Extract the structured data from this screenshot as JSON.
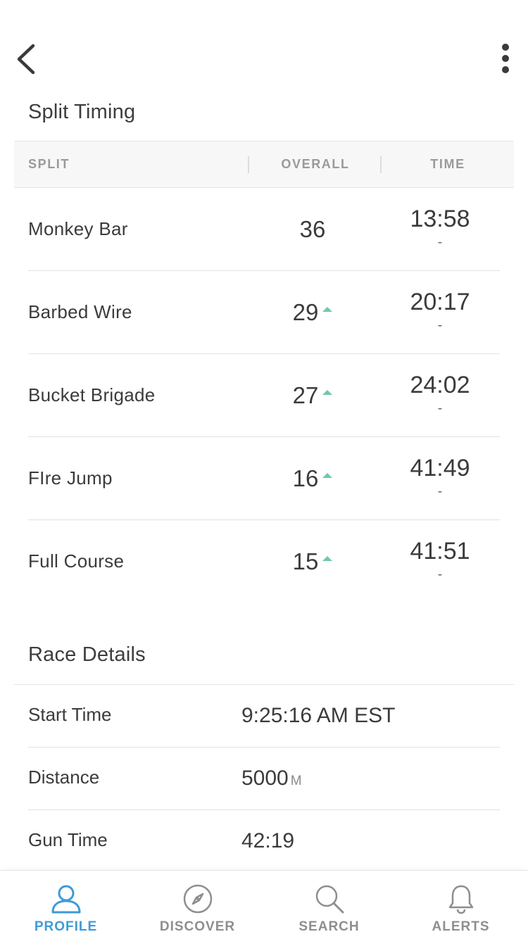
{
  "header": {
    "back_icon": "chevron-left-icon",
    "more_icon": "more-vertical-icon"
  },
  "split_timing": {
    "title": "Split Timing",
    "columns": {
      "split": "SPLIT",
      "overall": "OVERALL",
      "time": "TIME"
    },
    "rows": [
      {
        "name": "Monkey Bar",
        "overall": "36",
        "improved": false,
        "time": "13:58",
        "sub": "-"
      },
      {
        "name": "Barbed Wire",
        "overall": "29",
        "improved": true,
        "time": "20:17",
        "sub": "-"
      },
      {
        "name": "Bucket Brigade",
        "overall": "27",
        "improved": true,
        "time": "24:02",
        "sub": "-"
      },
      {
        "name": "FIre Jump",
        "overall": "16",
        "improved": true,
        "time": "41:49",
        "sub": "-"
      },
      {
        "name": "Full Course",
        "overall": "15",
        "improved": true,
        "time": "41:51",
        "sub": "-"
      }
    ],
    "improve_color": "#6fc9a4"
  },
  "race_details": {
    "title": "Race Details",
    "rows": [
      {
        "label": "Start Time",
        "value": "9:25:16 AM EST",
        "unit": ""
      },
      {
        "label": "Distance",
        "value": "5000",
        "unit": "M"
      },
      {
        "label": "Gun Time",
        "value": "42:19",
        "unit": ""
      }
    ]
  },
  "tabbar": {
    "tabs": [
      {
        "label": "PROFILE",
        "icon": "user-icon",
        "active": true
      },
      {
        "label": "DISCOVER",
        "icon": "compass-icon",
        "active": false
      },
      {
        "label": "SEARCH",
        "icon": "search-icon",
        "active": false
      },
      {
        "label": "ALERTS",
        "icon": "bell-icon",
        "active": false
      }
    ],
    "active_color": "#3f9ad6",
    "inactive_color": "#8e8e8e"
  }
}
